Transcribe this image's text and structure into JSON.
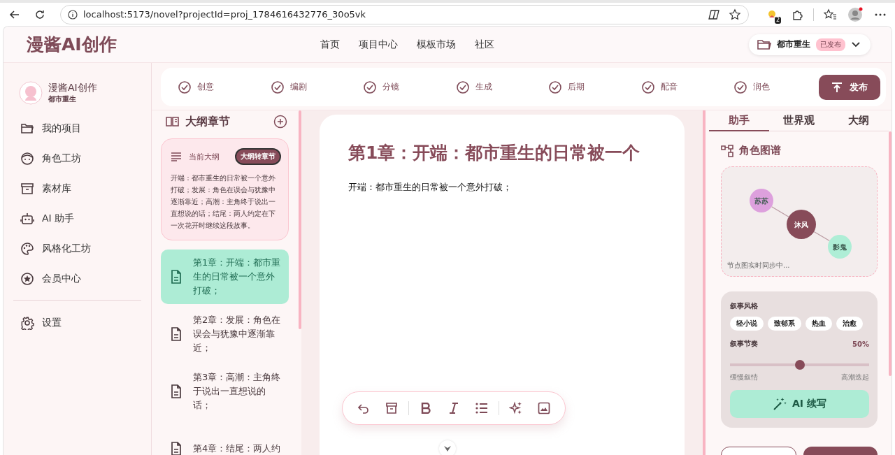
{
  "browser": {
    "url": "localhost:5173/novel?projectId=proj_1784616432776_30o5vk",
    "extension_badge": "2"
  },
  "header": {
    "logo": "漫酱AI创作",
    "nav": [
      "首页",
      "项目中心",
      "模板市场",
      "社区"
    ],
    "project": {
      "name": "都市重生",
      "status": "已发布"
    }
  },
  "sidebar": {
    "brand": "漫酱AI创作",
    "project": "都市重生",
    "items": [
      {
        "label": "我的项目"
      },
      {
        "label": "角色工坊"
      },
      {
        "label": "素材库"
      },
      {
        "label": "AI 助手"
      },
      {
        "label": "风格化工坊"
      },
      {
        "label": "会员中心"
      }
    ],
    "footer_items": [
      {
        "label": "设置"
      }
    ]
  },
  "stepper": {
    "steps": [
      {
        "label": "创意",
        "done": true
      },
      {
        "label": "编剧",
        "done": true
      },
      {
        "label": "分镜",
        "done": true
      },
      {
        "label": "生成",
        "done": true
      },
      {
        "label": "后期",
        "done": true
      },
      {
        "label": "配音",
        "done": true
      },
      {
        "label": "润色",
        "done": true
      }
    ],
    "publish": "发布"
  },
  "outline": {
    "title": "大纲章节",
    "current": {
      "label": "当前大纲",
      "action": "大纲转章节",
      "text": "开端：都市重生的日常被一个意外打破；发展：角色在误会与犹豫中逐渐靠近；高潮：主角终于说出一直想说的话；结尾：两人约定在下一次花开时继续这段故事。"
    },
    "chapters": [
      {
        "title": "第1章：开端：都市重生的日常被一个意外打破；",
        "selected": true
      },
      {
        "title": "第2章：发展：角色在误会与犹豫中逐渐靠近；",
        "selected": false
      },
      {
        "title": "第3章：高潮：主角终于说出一直想说的话；",
        "selected": false
      },
      {
        "title": "第4章：结尾：两人约",
        "selected": false
      }
    ]
  },
  "editor": {
    "title": "第1章：开端：都市重生的日常被一个",
    "body": "开端：都市重生的日常被一个意外打破；"
  },
  "panel": {
    "tabs": [
      {
        "label": "助手",
        "selected": true
      },
      {
        "label": "世界观",
        "selected": false
      },
      {
        "label": "大纲",
        "selected": false
      }
    ],
    "graph": {
      "title": "角色图谱",
      "nodes": [
        {
          "name": "苏苏",
          "color": "#dda0dd"
        },
        {
          "name": "沐风",
          "color": "#874b59"
        },
        {
          "name": "影鬼",
          "color": "#aeeed6"
        }
      ],
      "caption": "节点图实时同步中..."
    },
    "style": {
      "label": "叙事风格",
      "tags": [
        "轻小说",
        "致郁系",
        "热血",
        "治愈"
      ]
    },
    "pace": {
      "label": "叙事节奏",
      "reading": "50%",
      "level": 0.5,
      "min_label": "缓慢叙情",
      "max_label": "高潮迭起"
    },
    "action": "AI 续写"
  }
}
